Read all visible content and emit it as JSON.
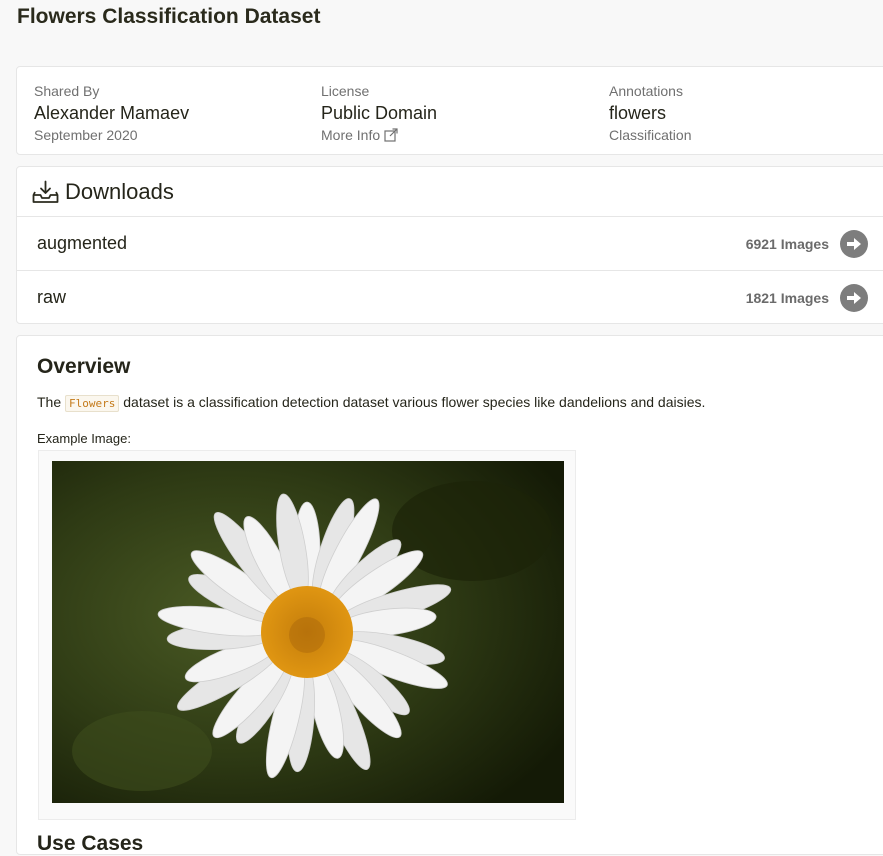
{
  "page": {
    "title": "Flowers Classification Dataset"
  },
  "meta": {
    "shared_by": {
      "label": "Shared By",
      "value": "Alexander Mamaev",
      "sub": "September 2020"
    },
    "license": {
      "label": "License",
      "value": "Public Domain",
      "sub": "More Info"
    },
    "annotations": {
      "label": "Annotations",
      "value": "flowers",
      "sub": "Classification"
    }
  },
  "downloads": {
    "title": "Downloads",
    "items": [
      {
        "name": "augmented",
        "count": "6921 Images"
      },
      {
        "name": "raw",
        "count": "1821 Images"
      }
    ]
  },
  "overview": {
    "title": "Overview",
    "text_before": "The",
    "code": "Flowers",
    "text_after": "dataset is a classification detection dataset various flower species like dandelions and daisies.",
    "example_label": "Example Image:",
    "next_heading": "Use Cases"
  },
  "colors": {
    "background": "#f8f8f8",
    "card": "#ffffff",
    "arrow_button": "#7d7d7d",
    "petal": "#f2f2f2",
    "center": "#d9900f",
    "foliage": "#2f3a16"
  },
  "icons": {
    "downloads": "download-tray-icon",
    "more_info": "external-link-icon",
    "row_action": "arrow-right-circle-icon"
  }
}
